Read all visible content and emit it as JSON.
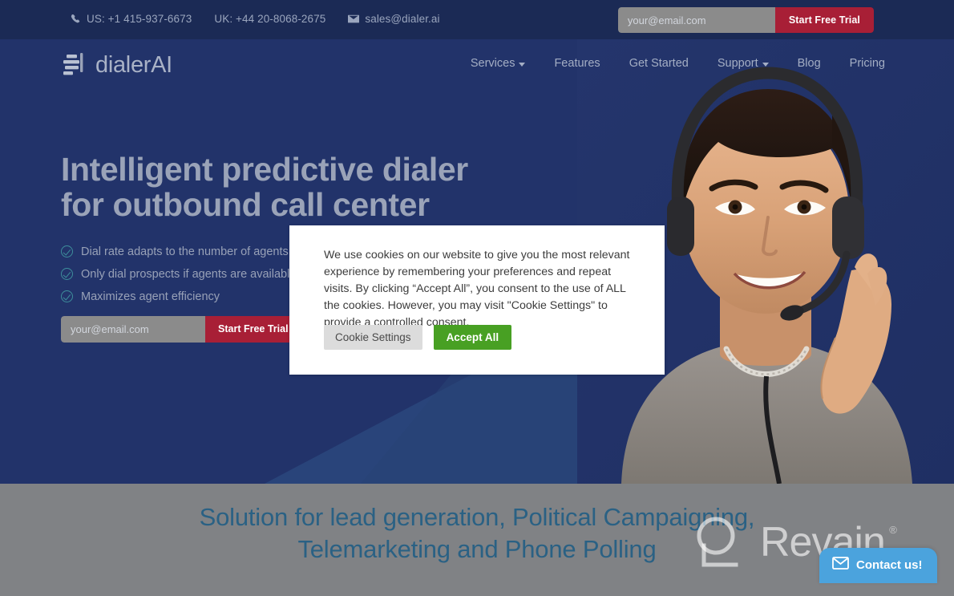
{
  "topbar": {
    "phone_icon": "phone-icon",
    "mail_icon": "envelope-icon",
    "us_phone": "US: +1 415-937-6673",
    "uk_phone": "UK: +44 20-8068-2675",
    "email": "sales@dialer.ai",
    "email_placeholder": "your@email.com",
    "email_value": "",
    "cta_label": "Start Free Trial"
  },
  "nav": {
    "logo_text": "dialerAI",
    "logo_mark_icon": "bars-logo-icon",
    "items": [
      {
        "label": "Services",
        "has_caret": true
      },
      {
        "label": "Features",
        "has_caret": false
      },
      {
        "label": "Get Started",
        "has_caret": false
      },
      {
        "label": "Support",
        "has_caret": true
      },
      {
        "label": "Blog",
        "has_caret": false
      },
      {
        "label": "Pricing",
        "has_caret": false
      }
    ]
  },
  "hero": {
    "title": "Intelligent predictive dialer\nfor outbound call center",
    "bullets": [
      "Dial rate adapts to the number of agents",
      "Only dial prospects if agents are available",
      "Maximizes agent efficiency"
    ],
    "check_icon": "check-circle-icon",
    "email_placeholder": "your@email.com",
    "email_value": "",
    "cta_label": "Start Free Trial",
    "photo_alt": "call-center-agent-photo"
  },
  "cookie_dialog": {
    "body": "We use cookies on our website to give you the most relevant experience by remembering your preferences and repeat visits. By clicking “Accept All”, you consent to the use of ALL the cookies. However, you may visit \"Cookie Settings\" to provide a controlled consent.",
    "settings_label": "Cookie Settings",
    "accept_label": "Accept All"
  },
  "gray_section": {
    "title": "Solution for lead generation, Political Campaigning,\nTelemarketing and Phone Polling"
  },
  "watermark": {
    "text": "Revain",
    "registered_mark": "®",
    "logo_icon": "revain-logo-icon"
  },
  "contact_fab": {
    "label": "Contact us!",
    "icon": "envelope-icon"
  },
  "colors": {
    "topbar_bg": "#1b2a55",
    "hero_bg": "#22336a",
    "hero_wedge": "#2a4a7f",
    "accent_red": "#a81f36",
    "accept_green": "#48a023",
    "gray_band": "#808285",
    "gray_title": "#2a6184",
    "fab_blue": "#4ba3dd",
    "check_teal": "#3e8f9c"
  }
}
